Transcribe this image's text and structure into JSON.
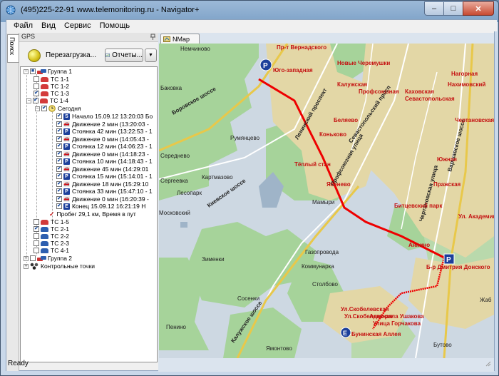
{
  "window": {
    "title": "(495)225-22-91   www.telemonitoring.ru - Navigator+",
    "controls": {
      "minimize": "–",
      "maximize": "□",
      "close": "✕"
    }
  },
  "menu": [
    "Файл",
    "Вид",
    "Сервис",
    "Помощь"
  ],
  "sidebar_tab": "Поиск",
  "panel": {
    "header": "GPS",
    "reload_label": "Перезагрузка...",
    "reports_label": "Отчеты..."
  },
  "tree": [
    {
      "label": "Группа 1",
      "type": "group"
    },
    {
      "label": "ТС 1-1",
      "type": "vehicle",
      "checked": false,
      "color": "#d33b3b"
    },
    {
      "label": "ТС 1-2",
      "type": "vehicle",
      "checked": false,
      "color": "#d33b3b"
    },
    {
      "label": "ТС 1-3",
      "type": "vehicle",
      "checked": true,
      "color": "#d33b3b"
    },
    {
      "label": "ТС 1-4",
      "type": "vehicle",
      "checked": true,
      "color": "#d33b3b"
    },
    {
      "label": "Сегодня",
      "type": "day",
      "checked": true
    },
    {
      "label": "Начало 15.09.12 13:20:03  Бо",
      "type": "event",
      "icon": "S"
    },
    {
      "label": "Движение 2 мин (13:20:03 -",
      "type": "event",
      "icon": "car"
    },
    {
      "label": "Стоянка 42 мин (13:22:53 - 1",
      "type": "event",
      "icon": "P"
    },
    {
      "label": "Движение 0 мин (14:05:43 -",
      "type": "event",
      "icon": "car"
    },
    {
      "label": "Стоянка 12 мин (14:06:23 - 1",
      "type": "event",
      "icon": "P"
    },
    {
      "label": "Движение 0 мин (14:18:23 -",
      "type": "event",
      "icon": "car"
    },
    {
      "label": "Стоянка 10 мин (14:18:43 - 1",
      "type": "event",
      "icon": "P"
    },
    {
      "label": "Движение 45 мин (14:29:01",
      "type": "event",
      "icon": "car"
    },
    {
      "label": "Стоянка 15 мин (15:14:01 - 1",
      "type": "event",
      "icon": "P"
    },
    {
      "label": "Движение 18 мин (15:29:10",
      "type": "event",
      "icon": "car"
    },
    {
      "label": "Стоянка 33 мин (15:47:10 - 1",
      "type": "event",
      "icon": "P"
    },
    {
      "label": "Движение 0 мин (16:20:39 -",
      "type": "event",
      "icon": "car"
    },
    {
      "label": "Конец 15.09.12 16:21:19  Н",
      "type": "event",
      "icon": "E"
    },
    {
      "label": "Пробег 29,1 км, Время в пут",
      "type": "mileage"
    },
    {
      "label": "ТС 1-5",
      "type": "vehicle",
      "checked": false,
      "color": "#d33b3b"
    },
    {
      "label": "ТС 2-1",
      "type": "vehicle",
      "checked": true,
      "color": "#2d5fb0"
    },
    {
      "label": "ТС 2-2",
      "type": "vehicle",
      "checked": false,
      "color": "#2d5fb0"
    },
    {
      "label": "ТС 2-3",
      "type": "vehicle",
      "checked": false,
      "color": "#2d5fb0"
    },
    {
      "label": "ТС 4-1",
      "type": "vehicle",
      "checked": false,
      "color": "#2d5fb0"
    },
    {
      "label": "Группа 2",
      "type": "group"
    },
    {
      "label": "Контрольные точки",
      "type": "group"
    }
  ],
  "map": {
    "tab_label": "NMap",
    "places": [
      "Немчиново",
      "Румянцево",
      "Картмазово",
      "Московский",
      "Мамыри",
      "Газопровода",
      "Зименки",
      "Коммунарка",
      "Столбово",
      "Сосенки",
      "Пенино",
      "Ямонтово",
      "Бутово",
      "Жаб",
      "Баковка",
      "Середнево",
      "Сергеевка"
    ],
    "roads": [
      "Боровское шоссе",
      "Киевское шоссе",
      "Калужское шоссе",
      "Ленинский проспект",
      "Профсоюзная улица",
      "Севастопольский просп",
      "Варшавское шоссе",
      "Чертановская улица"
    ],
    "metro": [
      "Пр-т Вернадского",
      "Юго-западная",
      "Новые Черемушки",
      "Калужская",
      "Профсоюзная",
      "Беляево",
      "Коньково",
      "Тёплый стан",
      "Ясенево",
      "Битцевский парк",
      "Аннино",
      "Б-р Дмитрия Донского",
      "Ул.Скобелевская",
      "Ул.Скобелевская",
      "Адмирала Ушакова",
      "Улица Горчакова",
      "Бунинская Аллея",
      "Каховская",
      "Севастопольская",
      "Нахимовский",
      "Нагорная",
      "Чертановская",
      "Южная",
      "Пражская",
      "Ул. Академика"
    ],
    "misc": [
      "Лесопарк"
    ]
  },
  "status": "Ready"
}
